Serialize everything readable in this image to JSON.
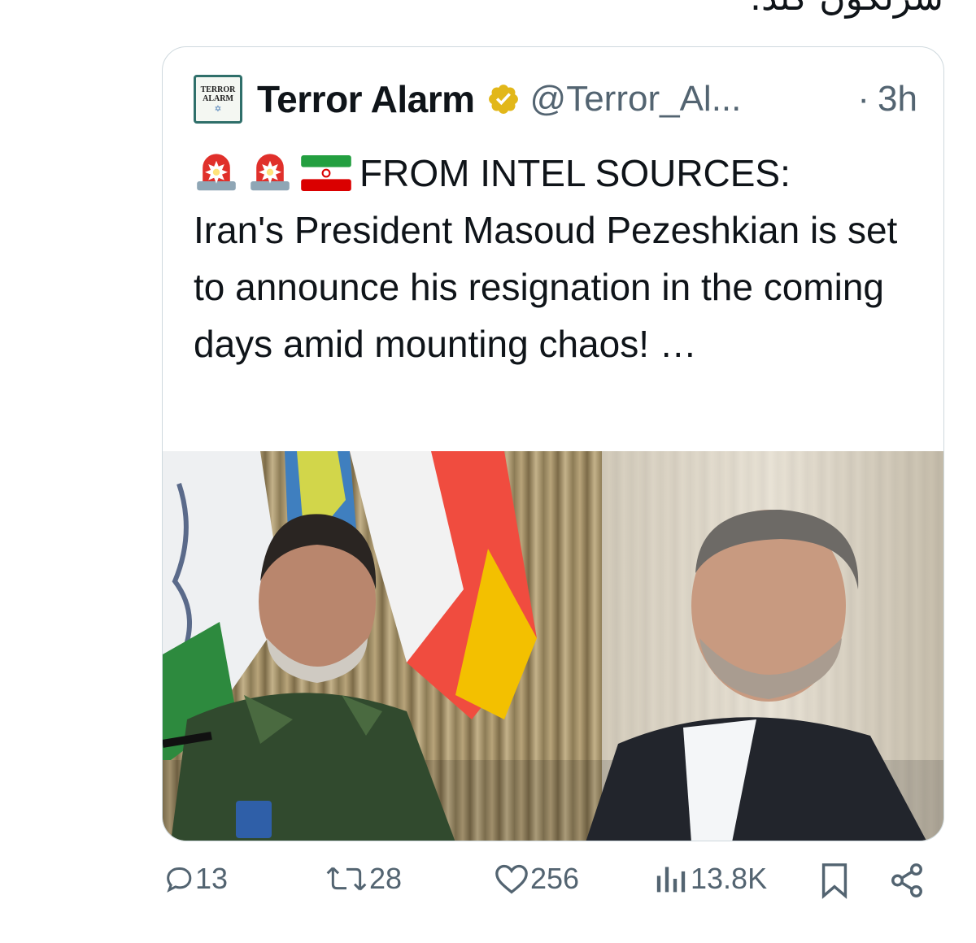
{
  "top_text": "سرنگون کند.",
  "quote": {
    "author_name": "Terror Alarm",
    "handle": "@Terror_Al...",
    "separator": "·",
    "time": "3h",
    "avatar_text_line1": "TERROR",
    "avatar_text_line2": "ALARM",
    "verified_badge": "gold-verified-badge-icon",
    "text_intro": "FROM INTEL SOURCES:",
    "text_body": "Iran's President Masoud Pezeshkian is set to announce his resignation in the coming days amid mounting chaos! …",
    "emojis": [
      "police-siren-icon",
      "police-siren-icon",
      "iran-flag-icon"
    ]
  },
  "actions": {
    "replies": "13",
    "reposts": "28",
    "likes": "256",
    "views": "13.8K"
  },
  "colors": {
    "muted_text": "#536471",
    "card_border": "#cfd9de",
    "badge_gold": "#e2b719"
  }
}
